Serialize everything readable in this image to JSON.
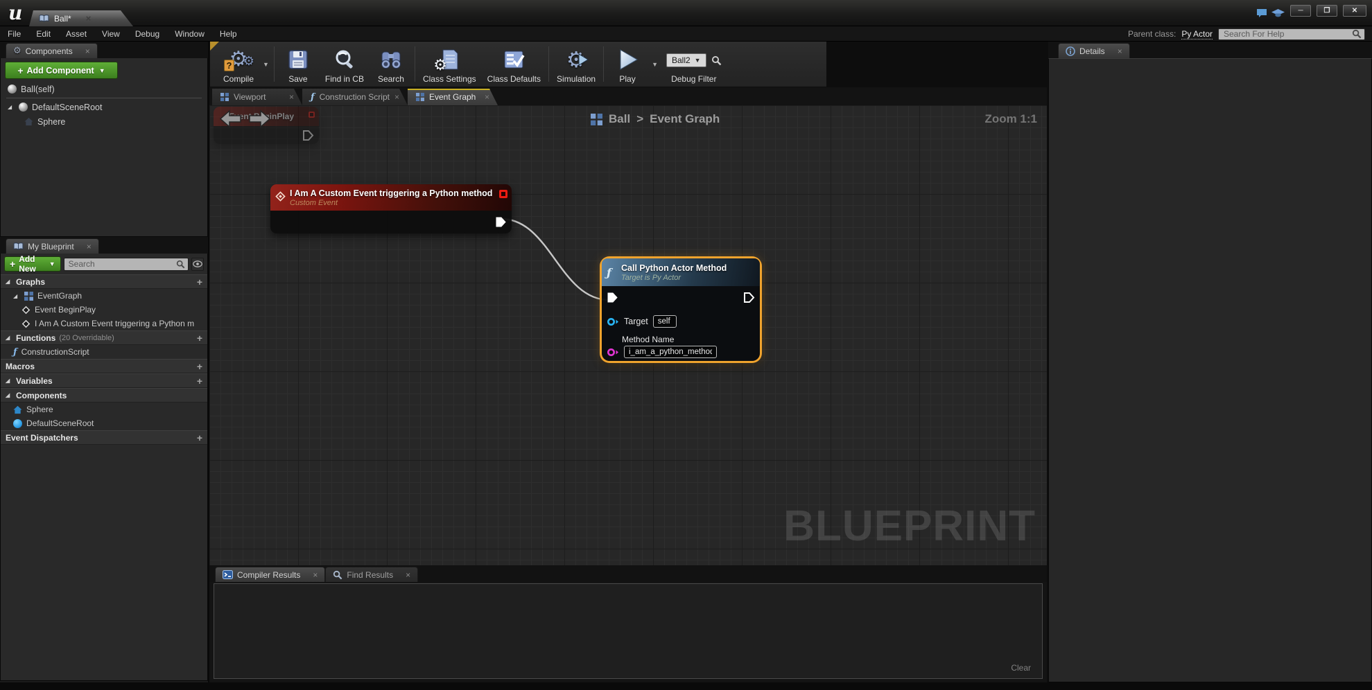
{
  "icons": {
    "close": "×",
    "caret_down": "▼",
    "plus": "+",
    "expander": "◢",
    "breadcrumb_sep": ">",
    "minimize": "─",
    "maximize": "❐",
    "close_window": "✕"
  },
  "titlebar": {
    "tab_label": "Ball*"
  },
  "menubar": {
    "items": [
      "File",
      "Edit",
      "Asset",
      "View",
      "Debug",
      "Window",
      "Help"
    ],
    "parent_class_label": "Parent class:",
    "parent_class_value": "Py Actor",
    "help_search_placeholder": "Search For Help"
  },
  "toolbar": {
    "compile_label": "Compile",
    "save_label": "Save",
    "find_in_cb_label": "Find in CB",
    "search_label": "Search",
    "class_settings_label": "Class Settings",
    "class_defaults_label": "Class Defaults",
    "simulation_label": "Simulation",
    "play_label": "Play",
    "debug_target_value": "Ball2",
    "debug_filter_label": "Debug Filter"
  },
  "components_panel": {
    "title": "Components",
    "add_component_label": "Add Component",
    "self_item": "Ball(self)",
    "scene_root_item": "DefaultSceneRoot",
    "sphere_item": "Sphere"
  },
  "my_blueprint": {
    "title": "My Blueprint",
    "add_new_label": "Add New",
    "search_placeholder": "Search",
    "graphs_header": "Graphs",
    "eventgraph_item": "EventGraph",
    "event_beginplay_item": "Event BeginPlay",
    "custom_event_item": "I Am A Custom Event triggering a Python m",
    "functions_header": "Functions",
    "functions_note": "(20 Overridable)",
    "construction_script_item": "ConstructionScript",
    "macros_header": "Macros",
    "variables_header": "Variables",
    "components_header": "Components",
    "sphere_item": "Sphere",
    "scene_root_item": "DefaultSceneRoot",
    "event_dispatchers_header": "Event Dispatchers"
  },
  "graph": {
    "tabs": {
      "viewport": "Viewport",
      "construction": "Construction Script",
      "event": "Event Graph"
    },
    "breadcrumb": {
      "root": "Ball",
      "current": "Event Graph"
    },
    "zoom_label": "Zoom 1:1",
    "watermark": "BLUEPRINT",
    "ghost_node": {
      "title": "Event BeginPlay"
    },
    "event_node": {
      "title": "I Am A Custom Event triggering a Python method",
      "subtitle": "Custom Event"
    },
    "call_node": {
      "title": "Call Python Actor Method",
      "subtitle": "Target is Py Actor",
      "target_label": "Target",
      "target_value": "self",
      "method_label": "Method Name",
      "method_value": "i_am_a_python_method"
    }
  },
  "bottom_panel": {
    "compiler_tab": "Compiler Results",
    "find_tab": "Find Results",
    "clear_label": "Clear"
  },
  "details_panel": {
    "title": "Details"
  },
  "colors": {
    "accent_green": "#4f9e31",
    "selection_orange": "#f0a32d",
    "event_node_red": "#8e211a",
    "function_node_blue": "#4e7396",
    "exec_pin": "#ffffff",
    "object_pin_blue": "#29b6f6",
    "name_pin_magenta": "#e335d4",
    "tab_active_yellow": "#c9b022",
    "wire": "#d9d9d9"
  }
}
